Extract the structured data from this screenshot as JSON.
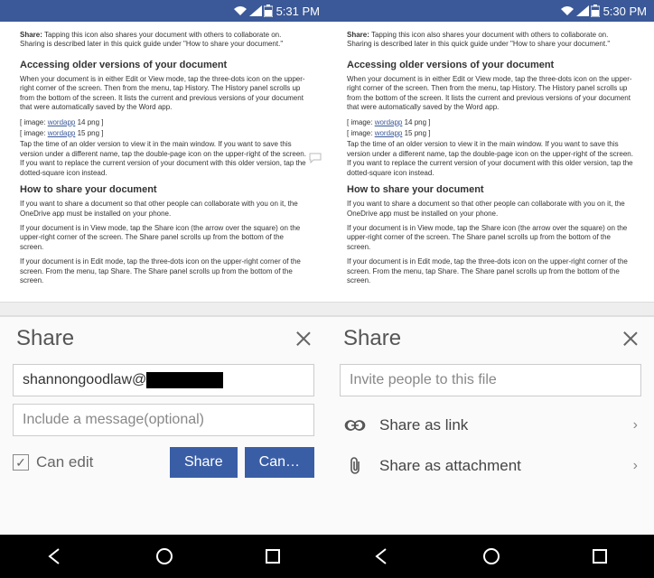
{
  "left": {
    "status_time": "5:31 PM",
    "share_title": "Share",
    "email_value": "shannongoodlaw@",
    "message_placeholder": "Include a message(optional)",
    "can_edit_label": "Can edit",
    "share_btn": "Share",
    "cancel_btn": "Can…"
  },
  "right": {
    "status_time": "5:30 PM",
    "share_title": "Share",
    "invite_placeholder": "Invite people to this file",
    "share_link_label": "Share as link",
    "share_attach_label": "Share as attachment"
  },
  "doc": {
    "share_line_bold": "Share:",
    "share_line_rest": " Tapping this icon also shares your document with others to collaborate on. Sharing is described later in this quick guide under \"How to share your document.\"",
    "heading1": "Accessing older versions of your document",
    "p1": "When your document is in either Edit or View mode, tap the three-dots icon on the upper-right corner of the screen. Then from the menu, tap History. The History panel scrolls up from the bottom of the screen. It lists the current and previous versions of your document that were automatically saved by the Word app.",
    "img1_pre": "[ image: ",
    "img1_link": "wordapp",
    "img1_post": " 14 png ]",
    "img2_pre": "[ image: ",
    "img2_link": "wordapp",
    "img2_post": " 15 png ]",
    "p2": "Tap the time of an older version to view it in the main window. If you want to save this version under a different name, tap the double-page icon on the upper-right of the screen. If you want to replace the current version of your document with this older version, tap the dotted-square icon instead.",
    "heading2": "How to share your document",
    "p3": "If you want to share a document so that other people can collaborate with you on it, the OneDrive app must be installed on your phone.",
    "p4": "If your document is in View mode, tap the Share icon (the arrow over the square) on the upper-right corner of the screen. The Share panel scrolls up from the bottom of the screen.",
    "p5": "If your document is in Edit mode, tap the three-dots icon on the upper-right corner of the screen. From the menu, tap Share. The Share panel scrolls up from the bottom of the screen."
  }
}
